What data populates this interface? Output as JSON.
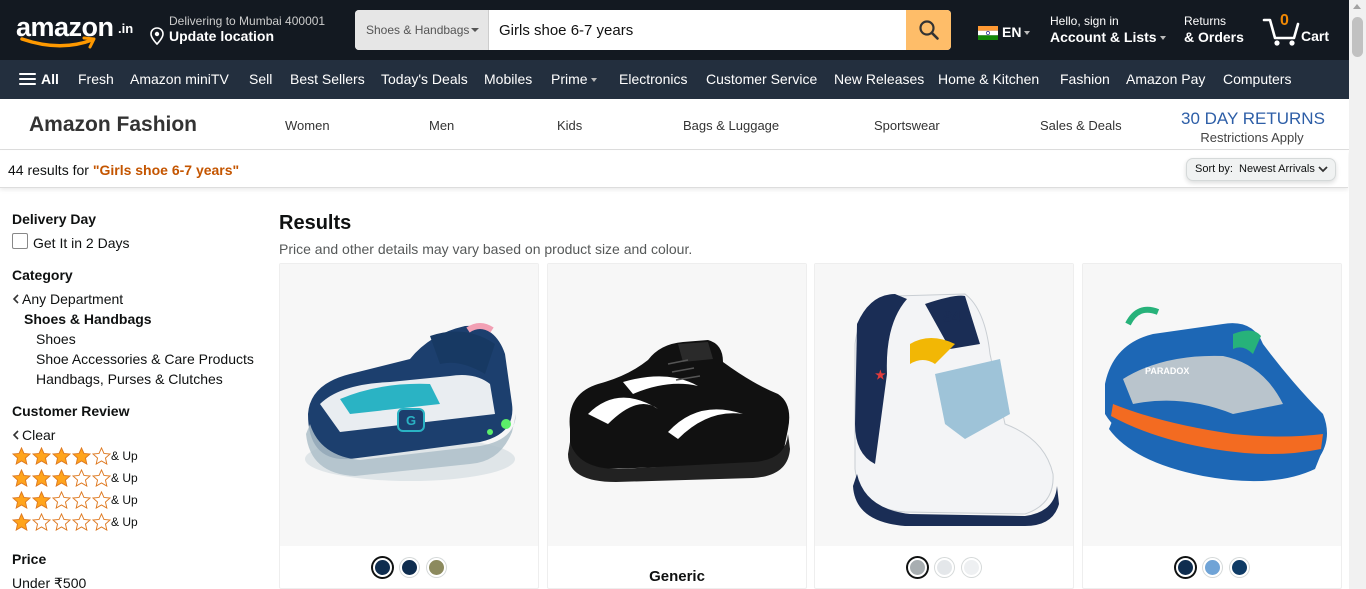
{
  "header": {
    "logo_text": "amazon",
    "logo_domain": ".in",
    "deliver_line1": "Delivering to Mumbai 400001",
    "deliver_line2": "Update location",
    "search_category": "Shoes & Handbags",
    "search_query": "Girls shoe 6-7 years",
    "language": "EN",
    "account_line1": "Hello, sign in",
    "account_line2": "Account & Lists",
    "returns_line1": "Returns",
    "returns_line2": "& Orders",
    "cart_count": "0",
    "cart_label": "Cart"
  },
  "subnav": {
    "all_label": "All",
    "items": [
      "Fresh",
      "Amazon miniTV",
      "Sell",
      "Best Sellers",
      "Today's Deals",
      "Mobiles",
      "Prime",
      "Electronics",
      "Customer Service",
      "New Releases",
      "Home & Kitchen",
      "Fashion",
      "Amazon Pay",
      "Computers"
    ]
  },
  "fashion_bar": {
    "title": "Amazon Fashion",
    "links": [
      "Women",
      "Men",
      "Kids",
      "Bags & Luggage",
      "Sportswear",
      "Sales & Deals"
    ],
    "returns_title": "30 DAY RETURNS",
    "returns_sub": "Restrictions Apply"
  },
  "results_bar": {
    "count_text": "44 results for ",
    "query_text": "\"Girls shoe 6-7 years\"",
    "sort_label": "Sort by:",
    "sort_value": "Newest Arrivals"
  },
  "sidebar": {
    "delivery_heading": "Delivery Day",
    "delivery_option": "Get It in 2 Days",
    "category_heading": "Category",
    "any_department": "Any Department",
    "current_category": "Shoes & Handbags",
    "subcategories": [
      "Shoes",
      "Shoe Accessories & Care Products",
      "Handbags, Purses & Clutches"
    ],
    "review_heading": "Customer Review",
    "review_clear": "Clear",
    "ratings": [
      {
        "stars": 4,
        "label": "& Up"
      },
      {
        "stars": 3,
        "label": "& Up"
      },
      {
        "stars": 2,
        "label": "& Up"
      },
      {
        "stars": 1,
        "label": "& Up"
      }
    ],
    "price_heading": "Price",
    "price_option": "Under ₹500"
  },
  "main": {
    "results_heading": "Results",
    "results_sub": "Price and other details may vary based on product size and colour.",
    "products": [
      {
        "image": "light-up-sneaker-teal-navy-icon",
        "swatches": [
          "#0f2d4f",
          "#0f2d4f",
          "#8c8a5e"
        ],
        "brand": ""
      },
      {
        "image": "black-sneaker-icon",
        "swatches": [],
        "brand": "Generic"
      },
      {
        "image": "white-navy-sneaker-icon",
        "swatches": [
          "#a8aeb1",
          "#e4e7ea",
          "#eef0f2"
        ],
        "brand": ""
      },
      {
        "image": "blue-orange-sneaker-icon",
        "swatches": [
          "#0f2d4f",
          "#6fa3d6",
          "#0f3b66"
        ],
        "brand": ""
      }
    ]
  },
  "colors": {
    "nav_dark": "#131921",
    "subnav": "#232f3e",
    "search_button": "#febd69",
    "query_highlight": "#c45500",
    "returns_blue": "#2d5ea7",
    "star": "#ffa41c"
  }
}
